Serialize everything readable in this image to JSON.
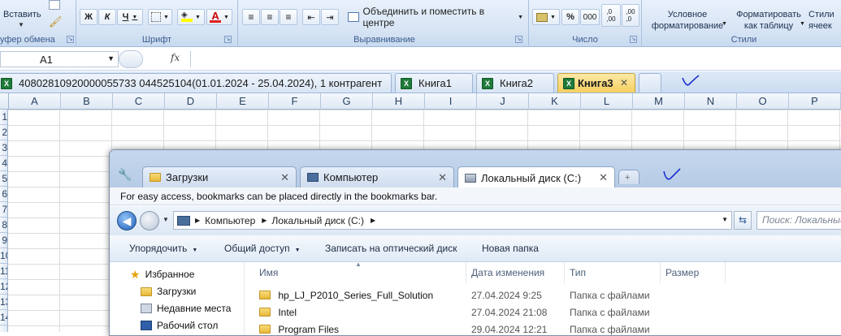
{
  "ribbon": {
    "clipboard": {
      "paste": "Вставить",
      "group": "уфер обмена"
    },
    "font": {
      "bold": "Ж",
      "italic": "К",
      "underline": "Ч",
      "group": "Шрифт"
    },
    "alignment": {
      "merge": "Объединить и поместить в центре",
      "group": "Выравнивание"
    },
    "number": {
      "percent": "%",
      "thousands": "000",
      "inc_dec": ",0\n,00",
      "dec_dec": ",00\n,0",
      "group": "Число"
    },
    "styles": {
      "conditional": "Условное\nформатирование",
      "format_table": "Форматировать\nкак таблицу",
      "cell_styles": "Стили\nячеек",
      "group": "Стили"
    }
  },
  "formula_bar": {
    "name_box": "A1",
    "fx": "fx",
    "value": ""
  },
  "workbook_tabs": [
    {
      "label": "40802810920000055733 044525104(01.01.2024 - 25.04.2024), 1 контрагент",
      "active": false
    },
    {
      "label": "Книга1",
      "active": false
    },
    {
      "label": "Книга2",
      "active": false
    },
    {
      "label": "Книга3",
      "active": true
    }
  ],
  "columns": [
    "A",
    "B",
    "C",
    "D",
    "E",
    "F",
    "G",
    "H",
    "I",
    "J",
    "K",
    "L",
    "M",
    "N",
    "O",
    "P"
  ],
  "rows": [
    "1",
    "2",
    "3",
    "4",
    "5",
    "6",
    "7",
    "8",
    "9",
    "10",
    "11",
    "12",
    "13",
    "14"
  ],
  "explorer": {
    "tabs": [
      {
        "label": "Загрузки",
        "active": false
      },
      {
        "label": "Компьютер",
        "active": false
      },
      {
        "label": "Локальный диск (C:)",
        "active": true
      }
    ],
    "bookmarks_hint": "For easy access, bookmarks can be placed directly in the bookmarks bar.",
    "breadcrumb": [
      "Компьютер",
      "Локальный диск (C:)"
    ],
    "search_placeholder": "Поиск: Локальный",
    "commands": [
      "Упорядочить",
      "Общий доступ",
      "Записать на оптический диск",
      "Новая папка"
    ],
    "nav_items": [
      "Избранное",
      "Загрузки",
      "Недавние места",
      "Рабочий стол"
    ],
    "columns": [
      "Имя",
      "Дата изменения",
      "Тип",
      "Размер"
    ],
    "files": [
      {
        "name": "hp_LJ_P2010_Series_Full_Solution",
        "date": "27.04.2024 9:25",
        "type": "Папка с файлами"
      },
      {
        "name": "Intel",
        "date": "27.04.2024 21:08",
        "type": "Папка с файлами"
      },
      {
        "name": "Program Files",
        "date": "29.04.2024 12:21",
        "type": "Папка с файлами"
      }
    ]
  },
  "colors": {
    "ribbon_bg": "#d5e3f4",
    "active_tab": "#f9d56e",
    "accent": "#1f7a3a"
  }
}
